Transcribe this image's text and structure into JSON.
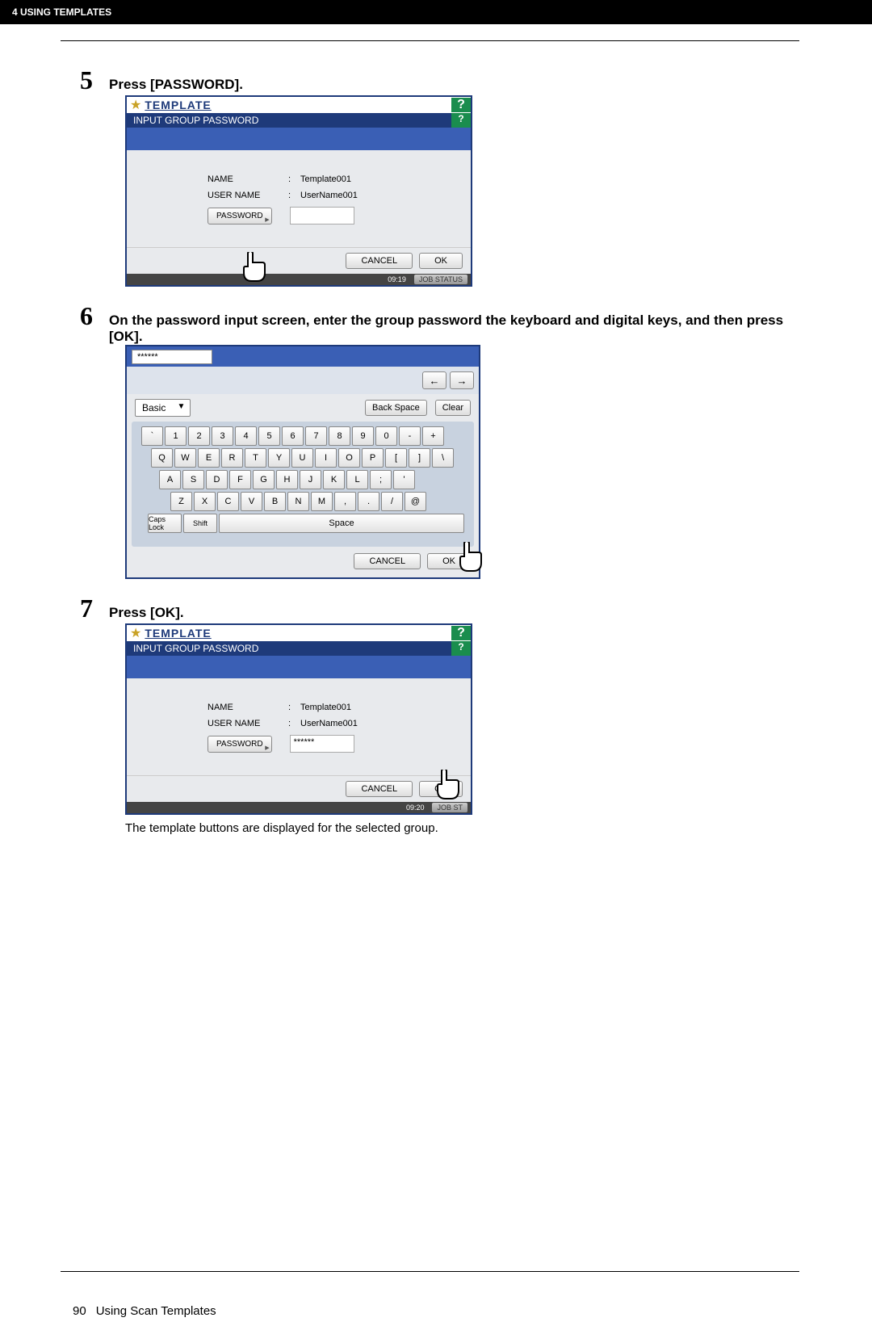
{
  "header": {
    "chapter": "4 USING TEMPLATES"
  },
  "step5": {
    "num": "5",
    "instruction": "Press [PASSWORD].",
    "screen": {
      "title": "TEMPLATE",
      "subtitle": "INPUT GROUP PASSWORD",
      "help": "?",
      "name_label": "NAME",
      "name_value": "Template001",
      "user_label": "USER NAME",
      "user_value": "UserName001",
      "pwd_btn": "PASSWORD",
      "cancel": "CANCEL",
      "ok": "OK",
      "time": "09:19",
      "job": "JOB STATUS"
    }
  },
  "step6": {
    "num": "6",
    "instruction": "On the password input screen, enter the group password the keyboard and digital keys, and then press [OK].",
    "screen": {
      "masked": "******",
      "mode": "Basic",
      "backspace": "Back Space",
      "clear": "Clear",
      "row1": [
        "`",
        "1",
        "2",
        "3",
        "4",
        "5",
        "6",
        "7",
        "8",
        "9",
        "0",
        "-",
        "+"
      ],
      "row2": [
        "Q",
        "W",
        "E",
        "R",
        "T",
        "Y",
        "U",
        "I",
        "O",
        "P",
        "[",
        "]",
        "\\"
      ],
      "row3": [
        "A",
        "S",
        "D",
        "F",
        "G",
        "H",
        "J",
        "K",
        "L",
        ";",
        "'"
      ],
      "row4": [
        "Z",
        "X",
        "C",
        "V",
        "B",
        "N",
        "M",
        ",",
        ".",
        "/",
        "@"
      ],
      "caps": "Caps Lock",
      "shift": "Shift",
      "space": "Space",
      "cancel": "CANCEL",
      "ok": "OK"
    }
  },
  "step7": {
    "num": "7",
    "instruction": "Press [OK].",
    "screen": {
      "title": "TEMPLATE",
      "subtitle": "INPUT GROUP PASSWORD",
      "help": "?",
      "name_label": "NAME",
      "name_value": "Template001",
      "user_label": "USER NAME",
      "user_value": "UserName001",
      "pwd_btn": "PASSWORD",
      "pwd_value": "******",
      "cancel": "CANCEL",
      "ok": "OK",
      "time": "09:20",
      "job": "JOB ST"
    },
    "caption": "The template buttons are displayed for the selected group."
  },
  "footer": {
    "page": "90",
    "title": "Using Scan Templates"
  }
}
